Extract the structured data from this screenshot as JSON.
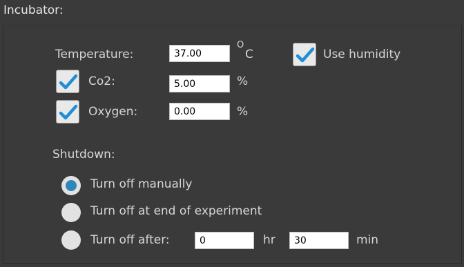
{
  "header": {
    "title": "Incubator:"
  },
  "incubator": {
    "temperature": {
      "label": "Temperature:",
      "value": "37.00",
      "unit_degree": "O",
      "unit_letter": "C"
    },
    "use_humidity": {
      "label": "Use humidity",
      "checked": true
    },
    "co2": {
      "label": "Co2:",
      "checked": true,
      "value": "5.00",
      "unit": "%"
    },
    "oxygen": {
      "label": "Oxygen:",
      "checked": true,
      "value": "0.00",
      "unit": "%"
    }
  },
  "shutdown": {
    "label": "Shutdown:",
    "options": [
      {
        "label": "Turn off manually",
        "selected": true
      },
      {
        "label": "Turn off at end of experiment",
        "selected": false
      },
      {
        "label": "Turn off after:",
        "selected": false
      }
    ],
    "after": {
      "hours_value": "0",
      "hours_unit": "hr",
      "minutes_value": "30",
      "minutes_unit": "min"
    }
  },
  "colors": {
    "background": "#3a3a3a",
    "text": "#d6d6d6",
    "checkmark": "#1f8ed6",
    "radio_selected": "#2f86b8",
    "radio_unselected": "#e2e2e2"
  },
  "icons": {
    "checkbox_mark": "checkmark-icon",
    "radio_selected": "radio-selected-icon",
    "radio_unselected": "radio-unselected-icon"
  }
}
